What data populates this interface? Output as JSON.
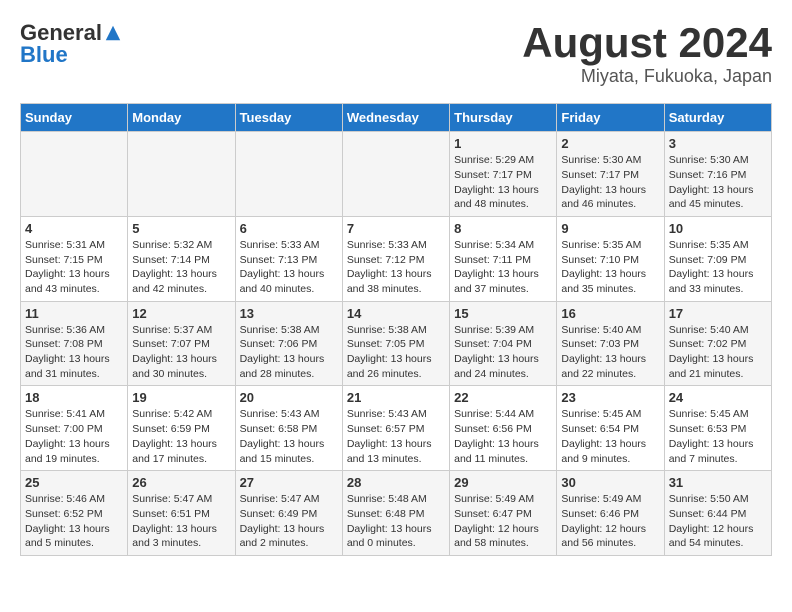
{
  "header": {
    "logo_general": "General",
    "logo_blue": "Blue",
    "month_title": "August 2024",
    "location": "Miyata, Fukuoka, Japan"
  },
  "weekdays": [
    "Sunday",
    "Monday",
    "Tuesday",
    "Wednesday",
    "Thursday",
    "Friday",
    "Saturday"
  ],
  "weeks": [
    {
      "days": [
        {
          "num": "",
          "info": ""
        },
        {
          "num": "",
          "info": ""
        },
        {
          "num": "",
          "info": ""
        },
        {
          "num": "",
          "info": ""
        },
        {
          "num": "1",
          "info": "Sunrise: 5:29 AM\nSunset: 7:17 PM\nDaylight: 13 hours\nand 48 minutes."
        },
        {
          "num": "2",
          "info": "Sunrise: 5:30 AM\nSunset: 7:17 PM\nDaylight: 13 hours\nand 46 minutes."
        },
        {
          "num": "3",
          "info": "Sunrise: 5:30 AM\nSunset: 7:16 PM\nDaylight: 13 hours\nand 45 minutes."
        }
      ]
    },
    {
      "days": [
        {
          "num": "4",
          "info": "Sunrise: 5:31 AM\nSunset: 7:15 PM\nDaylight: 13 hours\nand 43 minutes."
        },
        {
          "num": "5",
          "info": "Sunrise: 5:32 AM\nSunset: 7:14 PM\nDaylight: 13 hours\nand 42 minutes."
        },
        {
          "num": "6",
          "info": "Sunrise: 5:33 AM\nSunset: 7:13 PM\nDaylight: 13 hours\nand 40 minutes."
        },
        {
          "num": "7",
          "info": "Sunrise: 5:33 AM\nSunset: 7:12 PM\nDaylight: 13 hours\nand 38 minutes."
        },
        {
          "num": "8",
          "info": "Sunrise: 5:34 AM\nSunset: 7:11 PM\nDaylight: 13 hours\nand 37 minutes."
        },
        {
          "num": "9",
          "info": "Sunrise: 5:35 AM\nSunset: 7:10 PM\nDaylight: 13 hours\nand 35 minutes."
        },
        {
          "num": "10",
          "info": "Sunrise: 5:35 AM\nSunset: 7:09 PM\nDaylight: 13 hours\nand 33 minutes."
        }
      ]
    },
    {
      "days": [
        {
          "num": "11",
          "info": "Sunrise: 5:36 AM\nSunset: 7:08 PM\nDaylight: 13 hours\nand 31 minutes."
        },
        {
          "num": "12",
          "info": "Sunrise: 5:37 AM\nSunset: 7:07 PM\nDaylight: 13 hours\nand 30 minutes."
        },
        {
          "num": "13",
          "info": "Sunrise: 5:38 AM\nSunset: 7:06 PM\nDaylight: 13 hours\nand 28 minutes."
        },
        {
          "num": "14",
          "info": "Sunrise: 5:38 AM\nSunset: 7:05 PM\nDaylight: 13 hours\nand 26 minutes."
        },
        {
          "num": "15",
          "info": "Sunrise: 5:39 AM\nSunset: 7:04 PM\nDaylight: 13 hours\nand 24 minutes."
        },
        {
          "num": "16",
          "info": "Sunrise: 5:40 AM\nSunset: 7:03 PM\nDaylight: 13 hours\nand 22 minutes."
        },
        {
          "num": "17",
          "info": "Sunrise: 5:40 AM\nSunset: 7:02 PM\nDaylight: 13 hours\nand 21 minutes."
        }
      ]
    },
    {
      "days": [
        {
          "num": "18",
          "info": "Sunrise: 5:41 AM\nSunset: 7:00 PM\nDaylight: 13 hours\nand 19 minutes."
        },
        {
          "num": "19",
          "info": "Sunrise: 5:42 AM\nSunset: 6:59 PM\nDaylight: 13 hours\nand 17 minutes."
        },
        {
          "num": "20",
          "info": "Sunrise: 5:43 AM\nSunset: 6:58 PM\nDaylight: 13 hours\nand 15 minutes."
        },
        {
          "num": "21",
          "info": "Sunrise: 5:43 AM\nSunset: 6:57 PM\nDaylight: 13 hours\nand 13 minutes."
        },
        {
          "num": "22",
          "info": "Sunrise: 5:44 AM\nSunset: 6:56 PM\nDaylight: 13 hours\nand 11 minutes."
        },
        {
          "num": "23",
          "info": "Sunrise: 5:45 AM\nSunset: 6:54 PM\nDaylight: 13 hours\nand 9 minutes."
        },
        {
          "num": "24",
          "info": "Sunrise: 5:45 AM\nSunset: 6:53 PM\nDaylight: 13 hours\nand 7 minutes."
        }
      ]
    },
    {
      "days": [
        {
          "num": "25",
          "info": "Sunrise: 5:46 AM\nSunset: 6:52 PM\nDaylight: 13 hours\nand 5 minutes."
        },
        {
          "num": "26",
          "info": "Sunrise: 5:47 AM\nSunset: 6:51 PM\nDaylight: 13 hours\nand 3 minutes."
        },
        {
          "num": "27",
          "info": "Sunrise: 5:47 AM\nSunset: 6:49 PM\nDaylight: 13 hours\nand 2 minutes."
        },
        {
          "num": "28",
          "info": "Sunrise: 5:48 AM\nSunset: 6:48 PM\nDaylight: 13 hours\nand 0 minutes."
        },
        {
          "num": "29",
          "info": "Sunrise: 5:49 AM\nSunset: 6:47 PM\nDaylight: 12 hours\nand 58 minutes."
        },
        {
          "num": "30",
          "info": "Sunrise: 5:49 AM\nSunset: 6:46 PM\nDaylight: 12 hours\nand 56 minutes."
        },
        {
          "num": "31",
          "info": "Sunrise: 5:50 AM\nSunset: 6:44 PM\nDaylight: 12 hours\nand 54 minutes."
        }
      ]
    }
  ]
}
